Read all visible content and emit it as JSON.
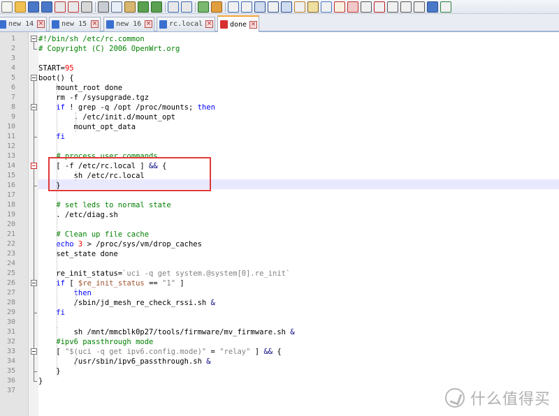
{
  "toolbar": {
    "icons": [
      {
        "name": "new-file-icon",
        "color": "#f5f5f0",
        "accent": "#7a7a7a"
      },
      {
        "name": "open-file-icon",
        "color": "#f0c050",
        "accent": "#b08020"
      },
      {
        "name": "save-icon",
        "color": "#4a78c8",
        "accent": "#2a4f90"
      },
      {
        "name": "save-all-icon",
        "color": "#4a78c8",
        "accent": "#2a4f90"
      },
      {
        "name": "close-file-icon",
        "color": "#e8e8e8",
        "accent": "#c03030"
      },
      {
        "name": "close-all-icon",
        "color": "#e8e8e8",
        "accent": "#c03030"
      },
      {
        "name": "print-icon",
        "color": "#d8d8d8",
        "accent": "#555555"
      },
      {
        "name": "cut-icon",
        "color": "#c8ccd4",
        "accent": "#555555"
      },
      {
        "name": "copy-icon",
        "color": "#e8eef8",
        "accent": "#5a6a8a"
      },
      {
        "name": "paste-icon",
        "color": "#d8b870",
        "accent": "#806020"
      },
      {
        "name": "undo-icon",
        "color": "#5aa050",
        "accent": "#2a7020"
      },
      {
        "name": "redo-icon",
        "color": "#5aa050",
        "accent": "#2a7020"
      },
      {
        "name": "find-icon",
        "color": "#e8e8e8",
        "accent": "#3a6ab0"
      },
      {
        "name": "replace-icon",
        "color": "#e8e8e8",
        "accent": "#3a6ab0"
      },
      {
        "name": "zoom-in-icon",
        "color": "#7ab870",
        "accent": "#2a7020"
      },
      {
        "name": "zoom-out-icon",
        "color": "#e0a040",
        "accent": "#a06010"
      },
      {
        "name": "sync-vertical-icon",
        "color": "#f0f0f0",
        "accent": "#3a6ab0"
      },
      {
        "name": "sync-horizontal-icon",
        "color": "#f0f0f0",
        "accent": "#3a6ab0"
      },
      {
        "name": "word-wrap-icon",
        "color": "#d0dcef",
        "accent": "#2a4f90"
      },
      {
        "name": "show-all-characters-icon",
        "color": "#f0f0f0",
        "accent": "#2a4f90"
      },
      {
        "name": "indent-guide-icon",
        "color": "#d0dcef",
        "accent": "#2a4f90"
      },
      {
        "name": "user-language-icon",
        "color": "#f0f0f0",
        "accent": "#c08020"
      },
      {
        "name": "document-map-icon",
        "color": "#f0e0a0",
        "accent": "#806020"
      },
      {
        "name": "function-list-icon",
        "color": "#f0f0f0",
        "accent": "#4a78c8"
      },
      {
        "name": "folder-workspace-icon",
        "color": "#f8f0e0",
        "accent": "#c03030"
      },
      {
        "name": "monitoring-icon",
        "color": "#f0c8c8",
        "accent": "#c03030"
      },
      {
        "name": "view-icon",
        "color": "#f0f0f0",
        "accent": "#555555"
      },
      {
        "name": "record-macro-icon",
        "color": "#f0f0f0",
        "accent": "#c02020"
      },
      {
        "name": "stop-recording-icon",
        "color": "#f0f0f0",
        "accent": "#555555"
      },
      {
        "name": "play-macro-icon",
        "color": "#f0f0f0",
        "accent": "#555555"
      },
      {
        "name": "run-macro-multiple-icon",
        "color": "#f0f0f0",
        "accent": "#555555"
      },
      {
        "name": "save-macro-icon",
        "color": "#4a78c8",
        "accent": "#2a4f90"
      },
      {
        "name": "spell-check-icon",
        "color": "#f0f0f0",
        "accent": "#2a8040"
      }
    ]
  },
  "tabs": [
    {
      "label": "new 14",
      "icon_color": "#3a6fd0",
      "active": false
    },
    {
      "label": "new 15",
      "icon_color": "#3a6fd0",
      "active": false
    },
    {
      "label": "new 16",
      "icon_color": "#3a6fd0",
      "active": false
    },
    {
      "label": "rc.local",
      "icon_color": "#3a6fd0",
      "active": false
    },
    {
      "label": "done",
      "icon_color": "#d83030",
      "active": true
    }
  ],
  "colors": {
    "keyword": "#0000ff",
    "comment": "#008000",
    "number": "#ff0000",
    "string": "#808080",
    "operator": "#000080",
    "variable": "#a0522d",
    "plain": "#000000",
    "highlight_box": "#e03838",
    "current_line": "#e8e8ff"
  },
  "editor": {
    "current_line": 16,
    "lines": [
      {
        "n": "1",
        "tokens": [
          {
            "t": "#!/bin/sh /etc/rc.common",
            "c": "comment"
          }
        ]
      },
      {
        "n": "2",
        "tokens": [
          {
            "t": "# Copyright (C) 2006 OpenWrt.org",
            "c": "comment"
          }
        ]
      },
      {
        "n": "3",
        "tokens": []
      },
      {
        "n": "4",
        "tokens": [
          {
            "t": "START=",
            "c": "plain"
          },
          {
            "t": "95",
            "c": "number"
          }
        ]
      },
      {
        "n": "5",
        "tokens": [
          {
            "t": "boot() {",
            "c": "plain"
          }
        ]
      },
      {
        "n": "6",
        "tokens": [
          {
            "t": "    mount_root done",
            "c": "plain"
          }
        ]
      },
      {
        "n": "7",
        "tokens": [
          {
            "t": "    rm -f /sysupgrade.tgz",
            "c": "plain"
          }
        ]
      },
      {
        "n": "8",
        "tokens": [
          {
            "t": "    ",
            "c": "plain"
          },
          {
            "t": "if",
            "c": "keyword"
          },
          {
            "t": " ! grep -q /opt /proc/mounts; ",
            "c": "plain"
          },
          {
            "t": "then",
            "c": "keyword"
          }
        ]
      },
      {
        "n": "9",
        "tokens": [
          {
            "t": "        . /etc/init.d/mount_opt",
            "c": "plain"
          }
        ]
      },
      {
        "n": "10",
        "tokens": [
          {
            "t": "        mount_opt_data",
            "c": "plain"
          }
        ]
      },
      {
        "n": "11",
        "tokens": [
          {
            "t": "    ",
            "c": "plain"
          },
          {
            "t": "fi",
            "c": "keyword"
          }
        ]
      },
      {
        "n": "12",
        "tokens": []
      },
      {
        "n": "13",
        "tokens": [
          {
            "t": "    # process user commands",
            "c": "comment"
          }
        ]
      },
      {
        "n": "14",
        "tokens": [
          {
            "t": "    [ -f /etc/rc.local ] ",
            "c": "plain"
          },
          {
            "t": "&&",
            "c": "operator"
          },
          {
            "t": " {",
            "c": "plain"
          }
        ]
      },
      {
        "n": "15",
        "tokens": [
          {
            "t": "        sh /etc/rc.local",
            "c": "plain"
          }
        ]
      },
      {
        "n": "16",
        "tokens": [
          {
            "t": "    }",
            "c": "plain"
          }
        ]
      },
      {
        "n": "17",
        "tokens": []
      },
      {
        "n": "18",
        "tokens": [
          {
            "t": "    # set leds to normal state",
            "c": "comment"
          }
        ]
      },
      {
        "n": "19",
        "tokens": [
          {
            "t": "    . /etc/diag.sh",
            "c": "plain"
          }
        ]
      },
      {
        "n": "20",
        "tokens": []
      },
      {
        "n": "21",
        "tokens": [
          {
            "t": "    # Clean up file cache",
            "c": "comment"
          }
        ]
      },
      {
        "n": "22",
        "tokens": [
          {
            "t": "    ",
            "c": "plain"
          },
          {
            "t": "echo",
            "c": "keyword"
          },
          {
            "t": " ",
            "c": "plain"
          },
          {
            "t": "3",
            "c": "number"
          },
          {
            "t": " > /proc/sys/vm/drop_caches",
            "c": "plain"
          }
        ]
      },
      {
        "n": "23",
        "tokens": [
          {
            "t": "    set_state done",
            "c": "plain"
          }
        ]
      },
      {
        "n": "24",
        "tokens": []
      },
      {
        "n": "25",
        "tokens": [
          {
            "t": "    re_init_status=",
            "c": "plain"
          },
          {
            "t": "`uci -q get system.@system[0].re_init`",
            "c": "string"
          }
        ]
      },
      {
        "n": "26",
        "tokens": [
          {
            "t": "    ",
            "c": "plain"
          },
          {
            "t": "if",
            "c": "keyword"
          },
          {
            "t": " [ ",
            "c": "plain"
          },
          {
            "t": "$re_init_status",
            "c": "variable"
          },
          {
            "t": " == ",
            "c": "plain"
          },
          {
            "t": "\"1\"",
            "c": "string"
          },
          {
            "t": " ]",
            "c": "plain"
          }
        ]
      },
      {
        "n": "27",
        "tokens": [
          {
            "t": "        ",
            "c": "plain"
          },
          {
            "t": "then",
            "c": "keyword"
          }
        ]
      },
      {
        "n": "28",
        "tokens": [
          {
            "t": "        /sbin/jd_mesh_re_check_rssi.sh ",
            "c": "plain"
          },
          {
            "t": "&",
            "c": "operator"
          }
        ]
      },
      {
        "n": "29",
        "tokens": [
          {
            "t": "    ",
            "c": "plain"
          },
          {
            "t": "fi",
            "c": "keyword"
          }
        ]
      },
      {
        "n": "30",
        "tokens": []
      },
      {
        "n": "31",
        "tokens": [
          {
            "t": "        sh /mnt/mmcblk0p27/tools/firmware/mv_firmware.sh ",
            "c": "plain"
          },
          {
            "t": "&",
            "c": "operator"
          }
        ]
      },
      {
        "n": "32",
        "tokens": [
          {
            "t": "    #ipv6 passthrough mode",
            "c": "comment"
          }
        ]
      },
      {
        "n": "33",
        "tokens": [
          {
            "t": "    [ ",
            "c": "plain"
          },
          {
            "t": "\"$(uci -q get ipv6.config.mode)\"",
            "c": "string"
          },
          {
            "t": " = ",
            "c": "plain"
          },
          {
            "t": "\"relay\"",
            "c": "string"
          },
          {
            "t": " ] ",
            "c": "plain"
          },
          {
            "t": "&&",
            "c": "operator"
          },
          {
            "t": " {",
            "c": "plain"
          }
        ]
      },
      {
        "n": "34",
        "tokens": [
          {
            "t": "        /usr/sbin/ipv6_passthrough.sh ",
            "c": "plain"
          },
          {
            "t": "&",
            "c": "operator"
          }
        ]
      },
      {
        "n": "35",
        "tokens": [
          {
            "t": "    }",
            "c": "plain"
          }
        ]
      },
      {
        "n": "36",
        "tokens": [
          {
            "t": "}",
            "c": "plain"
          }
        ]
      },
      {
        "n": "37",
        "tokens": []
      }
    ]
  },
  "watermark": {
    "text": "什么值得买"
  }
}
